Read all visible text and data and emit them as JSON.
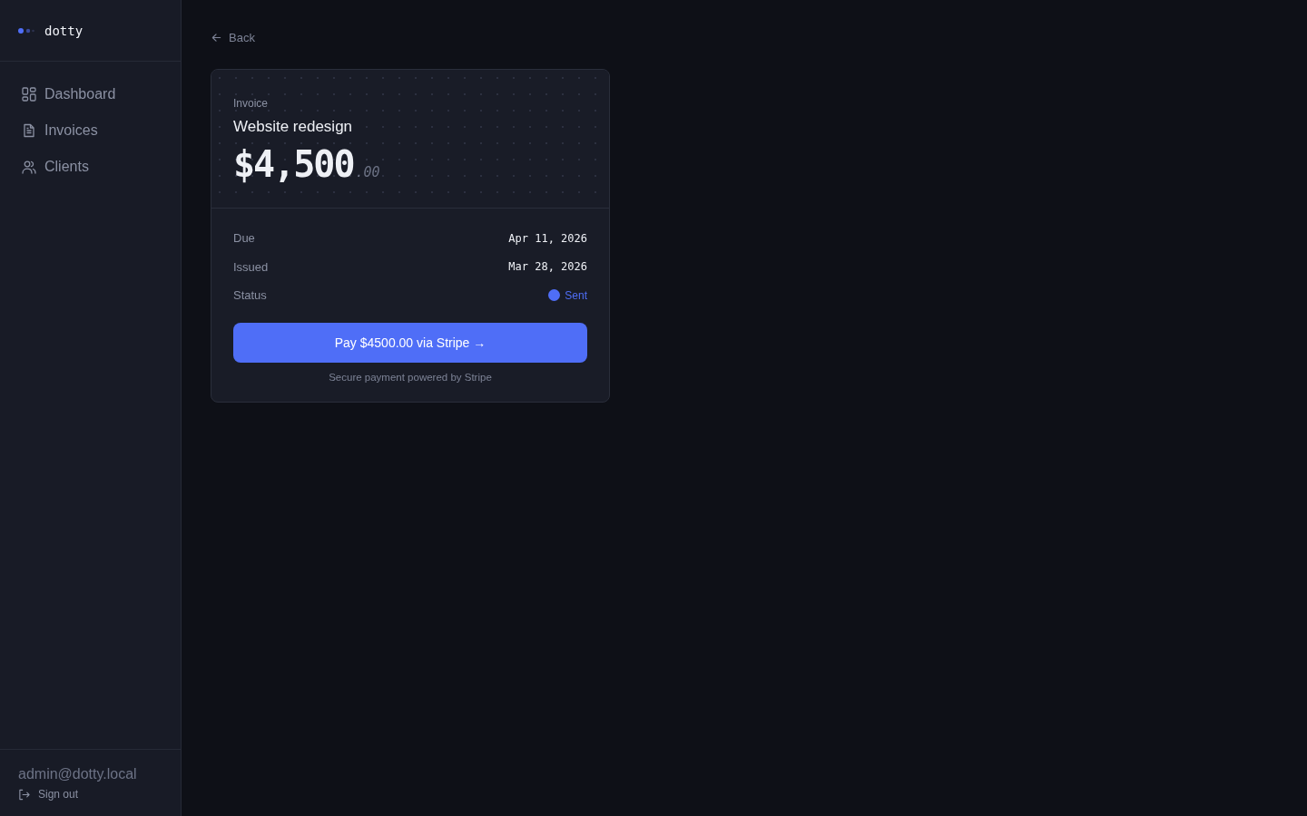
{
  "sidebar": {
    "brand": "dotty",
    "items": [
      {
        "label": "Dashboard",
        "selected": false
      },
      {
        "label": "Invoices",
        "selected": false
      },
      {
        "label": "Clients",
        "selected": false
      }
    ],
    "user_email": "admin@dotty.local",
    "sign_out": "Sign out"
  },
  "back_link": "Back",
  "invoice": {
    "eyebrow": "Invoice",
    "title": "Website redesign",
    "amount_whole": "$4,500",
    "amount_fraction": ".00",
    "details": [
      {
        "kind": "date",
        "label": "Due",
        "value": "Apr 11, 2026"
      },
      {
        "kind": "date",
        "label": "Issued",
        "value": "Mar 28, 2026"
      },
      {
        "kind": "status",
        "label": "Status",
        "value": "Sent",
        "color": "#4f6ef7"
      }
    ],
    "pay_button": "Pay $4500.00 via Stripe →",
    "footnote": "Secure payment powered by Stripe"
  }
}
